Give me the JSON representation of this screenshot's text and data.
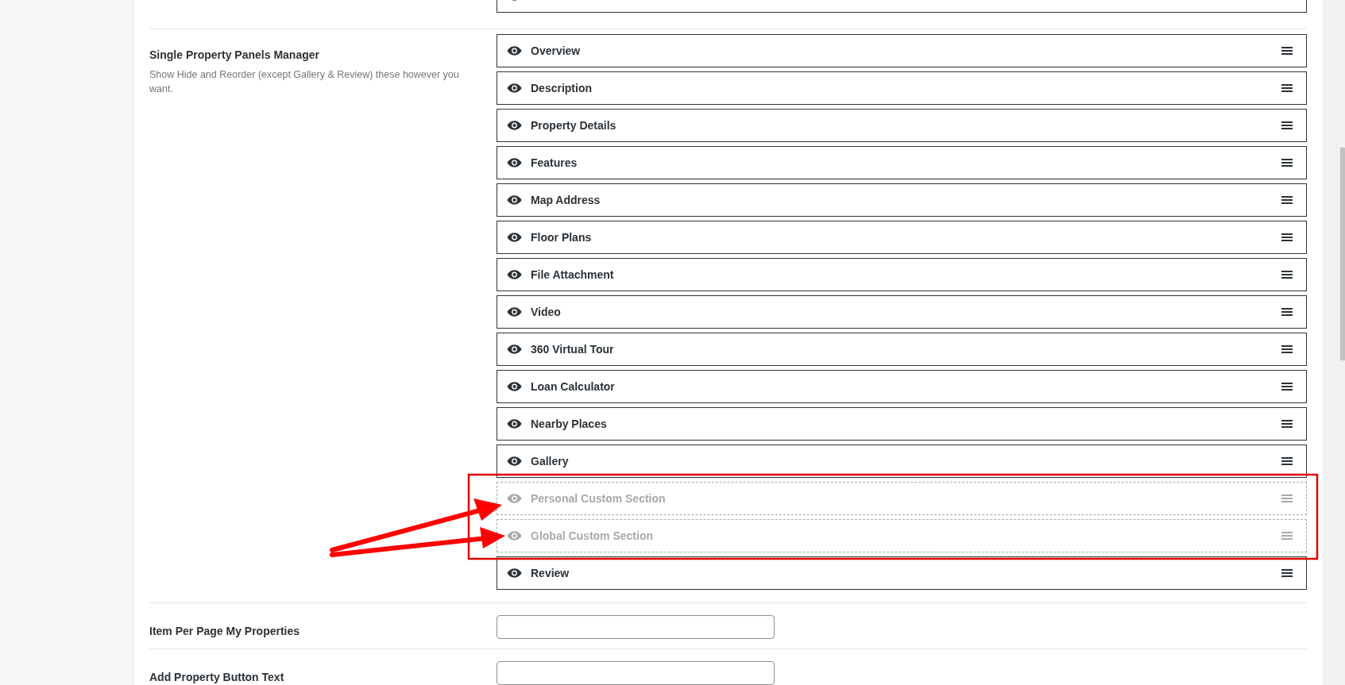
{
  "panels_manager": {
    "label": "Single Property Panels Manager",
    "description": "Show Hide and Reorder (except Gallery & Review) these however you want.",
    "above_item": {
      "hidden": false
    },
    "items": [
      {
        "name": "Overview",
        "hidden": false
      },
      {
        "name": "Description",
        "hidden": false
      },
      {
        "name": "Property Details",
        "hidden": false
      },
      {
        "name": "Features",
        "hidden": false
      },
      {
        "name": "Map Address",
        "hidden": false
      },
      {
        "name": "Floor Plans",
        "hidden": false
      },
      {
        "name": "File Attachment",
        "hidden": false
      },
      {
        "name": "Video",
        "hidden": false
      },
      {
        "name": "360 Virtual Tour",
        "hidden": false
      },
      {
        "name": "Loan Calculator",
        "hidden": false
      },
      {
        "name": "Nearby Places",
        "hidden": false
      },
      {
        "name": "Gallery",
        "hidden": false
      },
      {
        "name": "Personal Custom Section",
        "hidden": true
      },
      {
        "name": "Global Custom Section",
        "hidden": true
      },
      {
        "name": "Review",
        "hidden": false
      }
    ]
  },
  "fields": [
    {
      "label": "Item Per Page My Properties"
    },
    {
      "label": "Add Property Button Text"
    }
  ]
}
